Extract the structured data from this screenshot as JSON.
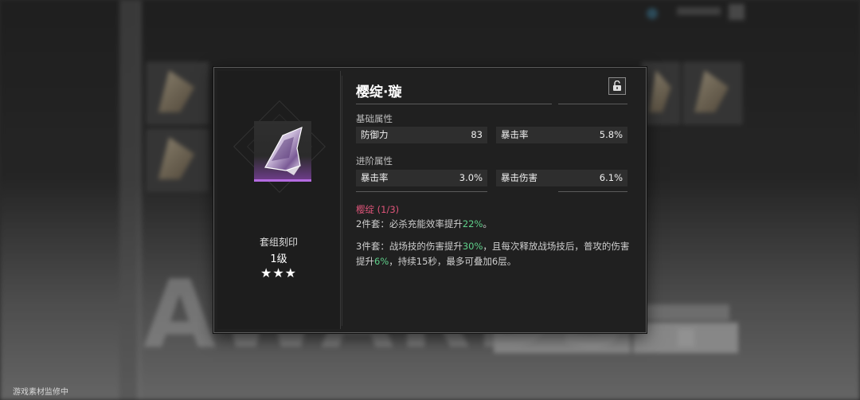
{
  "item": {
    "name": "樱绽·璇",
    "set_label": "套组刻印",
    "level": "1级",
    "stars": "★★★",
    "rarity_color": "#b46be0"
  },
  "base_attributes": {
    "label": "基础属性",
    "items": [
      {
        "name": "防御力",
        "value": "83"
      },
      {
        "name": "暴击率",
        "value": "5.8%"
      }
    ]
  },
  "advanced_attributes": {
    "label": "进阶属性",
    "items": [
      {
        "name": "暴击率",
        "value": "3.0%"
      },
      {
        "name": "暴击伤害",
        "value": "6.1%"
      }
    ]
  },
  "set_effect": {
    "name": "樱绽 (1/3)",
    "name_color": "#e0557a",
    "highlight_color": "#5fd08a",
    "two_piece": {
      "prefix": "2件套：必杀充能效率提升",
      "hl1": "22%",
      "suffix": "。"
    },
    "three_piece": {
      "prefix": "3件套：战场技的伤害提升",
      "hl1": "30%",
      "mid": "，且每次释放战场技后，普攻的伤害提升",
      "hl2": "6%",
      "suffix": "，持续15秒，最多可叠加6层。"
    }
  },
  "lock_icon": "unlock-icon",
  "watermark": "游戏素材监修中"
}
